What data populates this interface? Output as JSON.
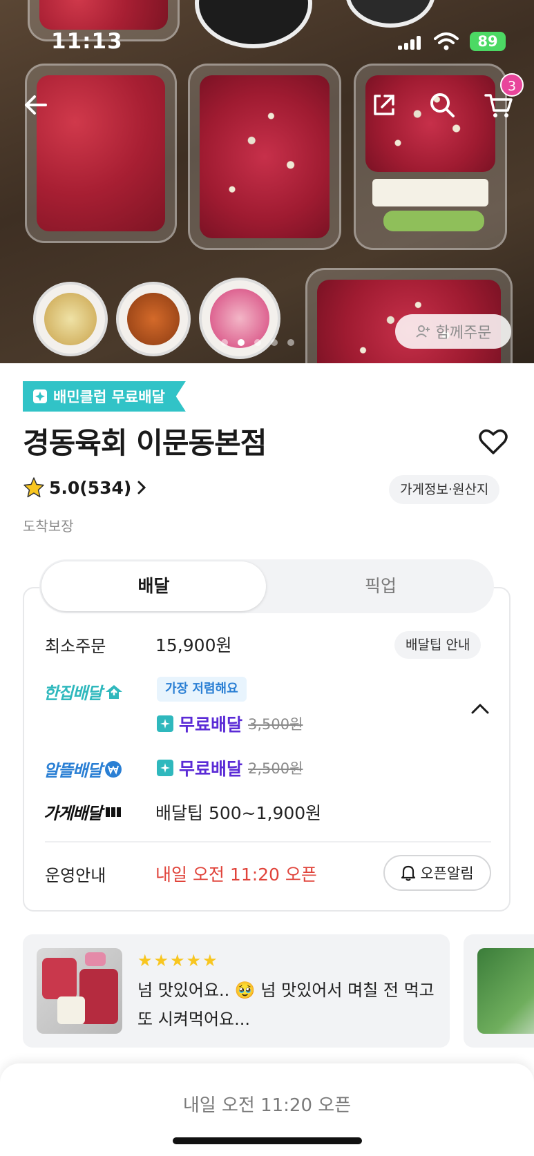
{
  "status_bar": {
    "time": "11:13",
    "battery": "89"
  },
  "hero": {
    "cart_count": "3",
    "together_order_label": "함께주문"
  },
  "store": {
    "club_badge": "배민클럽 무료배달",
    "name": "경동육회 이문동본점",
    "rating": "5.0(534)",
    "info_chip": "가게정보·원산지",
    "guarantee": "도착보장"
  },
  "tabs": {
    "delivery": "배달",
    "pickup": "픽업"
  },
  "delivery_card": {
    "min_order_label": "최소주문",
    "min_order_value": "15,900원",
    "tip_guide": "배달팁 안내",
    "hanjip_label": "한집배달",
    "cheapest_badge": "가장 저렴해요",
    "hanjip_free": "무료배달",
    "hanjip_price": "3,500원",
    "altteul_label": "알뜰배달",
    "altteul_free": "무료배달",
    "altteul_price": "2,500원",
    "store_delivery_label": "가게배달",
    "store_delivery_value": "배달팁 500~1,900원",
    "operation_label": "운영안내",
    "operation_value": "내일 오전 11:20 오픈",
    "alarm_button": "오픈알림"
  },
  "review": {
    "stars": "★★★★★",
    "text": "넘 맛있어요.. 🥹 넘 맛있어서 며칠 전 먹고 또 시켜먹어요..."
  },
  "bottom_bar": {
    "label": "내일 오전 11:20 오픈"
  },
  "colors": {
    "club_teal": "#31c3c7",
    "free_purple": "#5b2bd6",
    "open_red": "#e0433a",
    "cart_badge_pink": "#e8459b",
    "cheapest_blue": "#2a7fd4"
  }
}
